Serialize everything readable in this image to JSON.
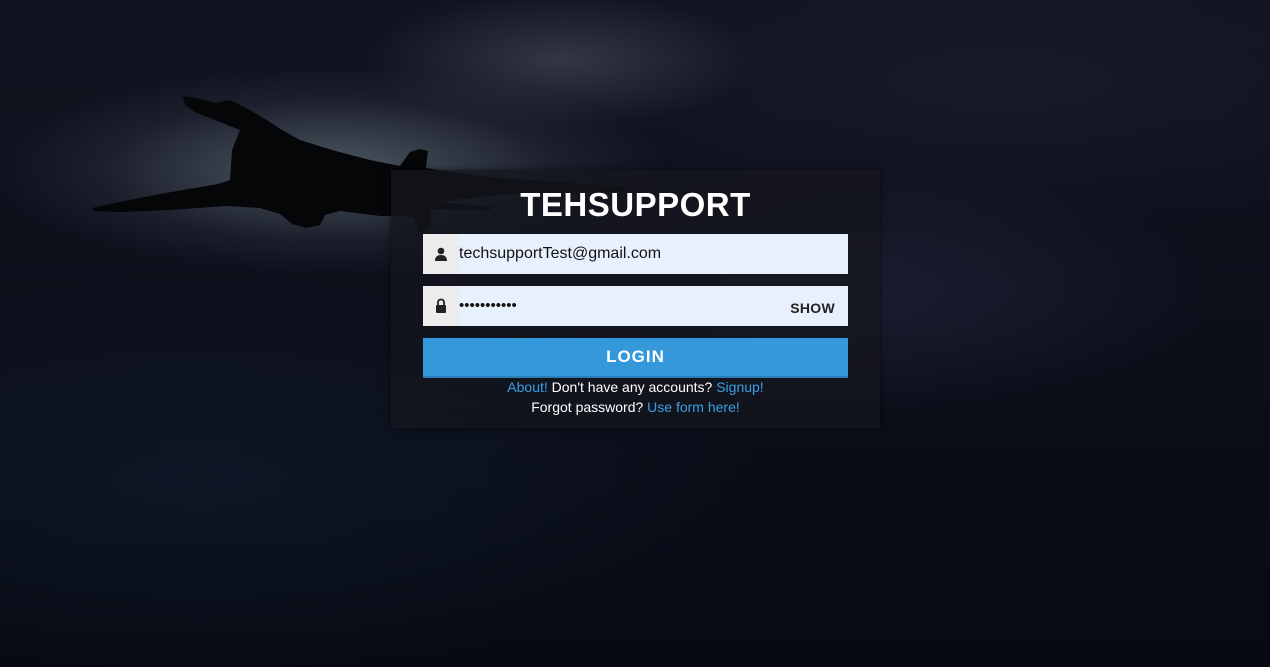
{
  "app": {
    "title": "TEHSUPPORT"
  },
  "form": {
    "email_value": "techsupportTest@gmail.com",
    "password_masked": "•••••••••••",
    "show_label": "SHOW",
    "login_label": "LOGIN"
  },
  "links": {
    "about_label": "About!",
    "no_account_text": " Don't have any accounts? ",
    "signup_label": "Signup!",
    "forgot_text": "Forgot password? ",
    "use_form_label": "Use form here",
    "forgot_suffix": "!"
  },
  "icons": {
    "user": "user-icon",
    "lock": "lock-icon",
    "background": "airplane-silhouette"
  },
  "colors": {
    "accent": "#3498db",
    "link": "#3aa0e6",
    "field_bg": "#e8f0fe",
    "panel_bg": "#14161e"
  }
}
